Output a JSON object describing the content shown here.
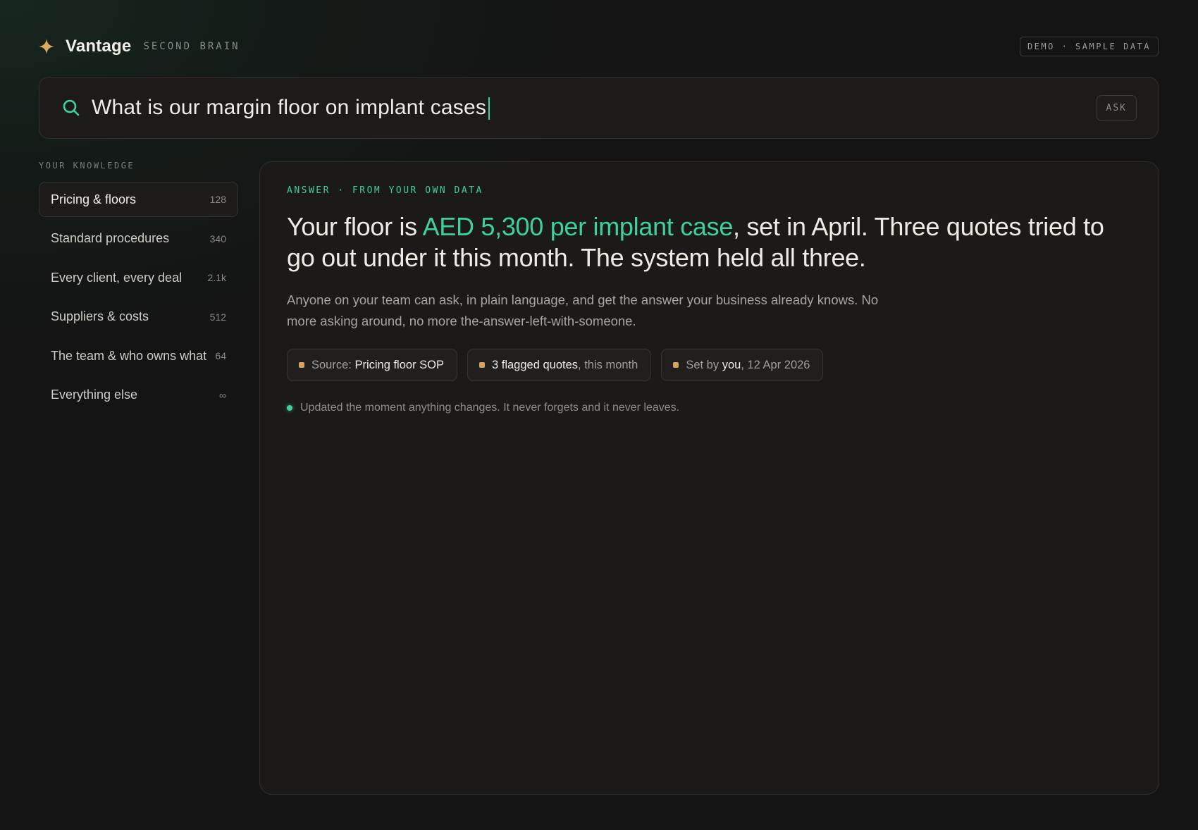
{
  "header": {
    "brand": "Vantage",
    "brand_sub": "SECOND BRAIN",
    "demo_badge": "DEMO · SAMPLE DATA",
    "logo_icon": "sparkle-icon"
  },
  "search": {
    "query": "What is our margin floor on implant cases",
    "icon": "search-icon",
    "ask_label": "ASK"
  },
  "sidebar": {
    "title": "YOUR KNOWLEDGE",
    "items": [
      {
        "label": "Pricing & floors",
        "count": "128",
        "active": true
      },
      {
        "label": "Standard procedures",
        "count": "340"
      },
      {
        "label": "Every client, every deal",
        "count": "2.1k"
      },
      {
        "label": "Suppliers & costs",
        "count": "512"
      },
      {
        "label": "The team & who owns what",
        "count": "64"
      },
      {
        "label": "Everything else",
        "count": "∞"
      }
    ]
  },
  "answer": {
    "eyebrow": "ANSWER · FROM YOUR OWN DATA",
    "headline_pre": "Your floor is ",
    "headline_highlight": "AED 5,300 per implant case",
    "headline_post": ", set in April. Three quotes tried to go out under it this month. The system held all three.",
    "body": "Anyone on your team can ask, in plain language, and get the answer your business already knows. No more asking around, no more the-answer-left-with-someone.",
    "chips": {
      "source": {
        "prefix": "Source: ",
        "value": "Pricing floor SOP"
      },
      "flagged": {
        "value": "3 flagged quotes",
        "suffix": ", this month"
      },
      "setby": {
        "prefix": "Set by ",
        "value": "you",
        "suffix": ", 12 Apr 2026"
      }
    },
    "update_note": "Updated the moment anything changes. It never forgets and it never leaves."
  },
  "colors": {
    "accent": "#3ed29a",
    "chip_marker": "#d4a35c",
    "logo": "#d9a95f"
  }
}
